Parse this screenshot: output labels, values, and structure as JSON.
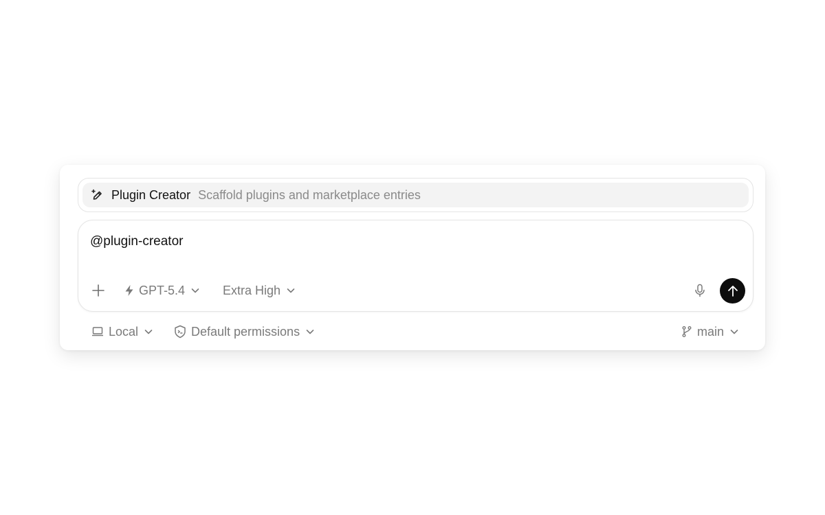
{
  "suggestion": {
    "name": "Plugin Creator",
    "description": "Scaffold plugins and marketplace entries",
    "icon": "magic-pen-icon"
  },
  "composer": {
    "input_value": "@plugin-creator",
    "add_icon": "plus-icon",
    "model": {
      "label": "GPT-5.4",
      "icon": "bolt-icon"
    },
    "effort": {
      "label": "Extra High"
    },
    "mic_icon": "microphone-icon",
    "send_icon": "arrow-up-icon"
  },
  "footer": {
    "environment": {
      "label": "Local",
      "icon": "laptop-icon"
    },
    "permissions": {
      "label": "Default permissions",
      "icon": "shield-icon"
    },
    "branch": {
      "label": "main",
      "icon": "git-branch-icon"
    }
  },
  "colors": {
    "text_primary": "#111111",
    "text_muted": "#7a7a7a",
    "suggestion_bg": "#f3f3f3",
    "send_button": "#0d0d0d"
  }
}
